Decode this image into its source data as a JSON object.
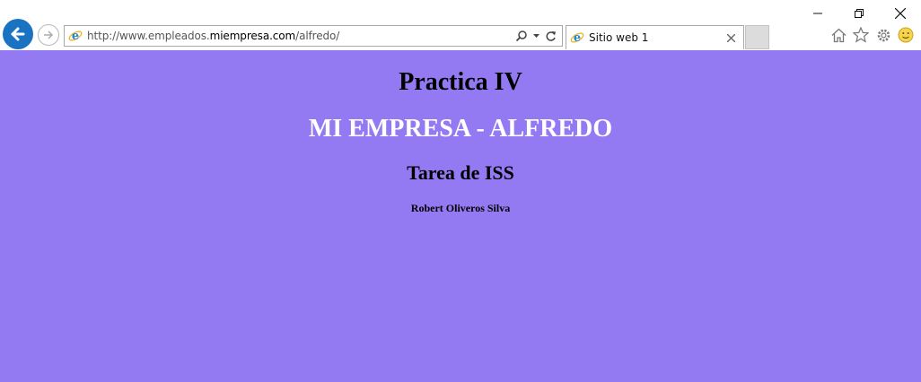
{
  "browser": {
    "address": {
      "prefix": "http://www.empleados.",
      "domain": "miempresa.com",
      "suffix": "/alfredo/"
    },
    "tab": {
      "title": "Sitio web 1"
    },
    "icons": {
      "back": "back-arrow-icon",
      "forward": "forward-arrow-icon",
      "search": "search-icon",
      "refresh": "refresh-icon",
      "home": "home-icon",
      "favorites": "star-icon",
      "settings": "gear-icon",
      "feedback": "smiley-icon"
    }
  },
  "page": {
    "background": "#937af2",
    "heading_1": "Practica IV",
    "heading_2": "MI EMPRESA - ALFREDO",
    "heading_3": "Tarea de ISS",
    "author": "Robert Oliveros Silva"
  }
}
